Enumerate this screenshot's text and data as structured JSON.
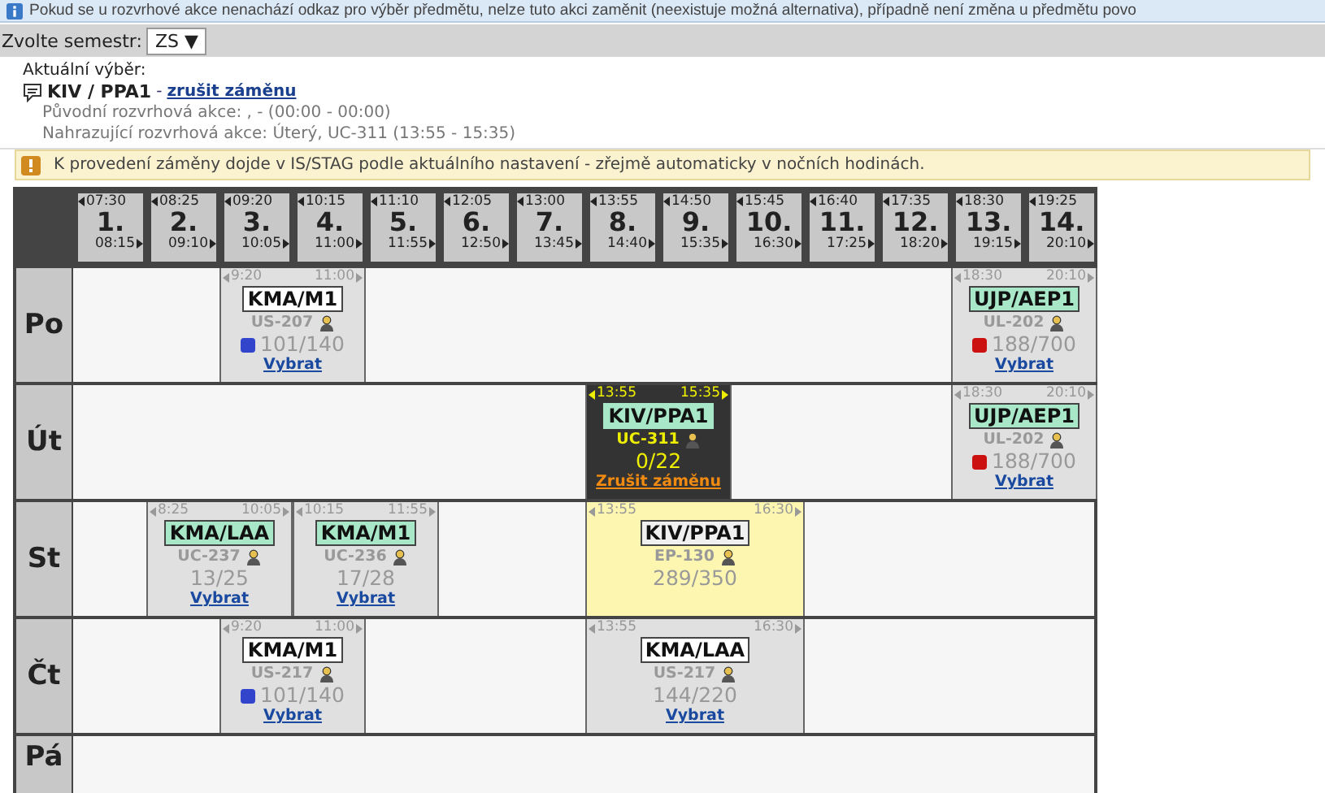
{
  "info_banner": {
    "text": "Pokud se u rozvrhové akce nenachází odkaz pro výběr předmětu, nelze tuto akci zaměnit (neexistuje možná alternativa), případně není změna u předmětu povo"
  },
  "semester": {
    "label": "Zvolte semestr:",
    "value": "ZS",
    "caret": "▼"
  },
  "current_selection": {
    "heading": "Aktuální výběr:",
    "course": "KIV / PPA1",
    "separator": "-",
    "cancel_link": "zrušit záměnu",
    "details": [
      "Původní rozvrhová akce: , - (00:00 - 00:00)",
      "Nahrazující rozvrhová akce: Úterý, UC-311 (13:55 - 15:35)"
    ]
  },
  "warning": {
    "text": "K provedení záměny dojde v IS/STAG podle aktuálního nastavení - zřejmě automaticky v nočních hodinách."
  },
  "timetable": {
    "slots": [
      {
        "number": "1.",
        "start": "07:30",
        "end": "08:15"
      },
      {
        "number": "2.",
        "start": "08:25",
        "end": "09:10"
      },
      {
        "number": "3.",
        "start": "09:20",
        "end": "10:05"
      },
      {
        "number": "4.",
        "start": "10:15",
        "end": "11:00"
      },
      {
        "number": "5.",
        "start": "11:10",
        "end": "11:55"
      },
      {
        "number": "6.",
        "start": "12:05",
        "end": "12:50"
      },
      {
        "number": "7.",
        "start": "13:00",
        "end": "13:45"
      },
      {
        "number": "8.",
        "start": "13:55",
        "end": "14:40"
      },
      {
        "number": "9.",
        "start": "14:50",
        "end": "15:35"
      },
      {
        "number": "10.",
        "start": "15:45",
        "end": "16:30"
      },
      {
        "number": "11.",
        "start": "16:40",
        "end": "17:25"
      },
      {
        "number": "12.",
        "start": "17:35",
        "end": "18:20"
      },
      {
        "number": "13.",
        "start": "18:30",
        "end": "19:15"
      },
      {
        "number": "14.",
        "start": "19:25",
        "end": "20:10"
      }
    ],
    "days": [
      {
        "label": "Po",
        "events": [
          {
            "kind": "normal",
            "start": "9:20",
            "end": "11:00",
            "code": "KMA/M1",
            "color": "#ffffff",
            "room": "US-207",
            "indicator": {
              "color": "#3344cc"
            },
            "capacity": "101/140",
            "link": "Vybrat"
          },
          {
            "kind": "normal",
            "start": "18:30",
            "end": "20:10",
            "code": "UJP/AEP1",
            "color": "#a8e8c8",
            "room": "UL-202",
            "indicator": {
              "color": "#cc1111"
            },
            "capacity": "188/700",
            "link": "Vybrat"
          }
        ]
      },
      {
        "label": "Út",
        "events": [
          {
            "kind": "current",
            "start": "13:55",
            "end": "15:35",
            "code": "KIV/PPA1",
            "color": "#a8e8c8",
            "room": "UC-311",
            "capacity": "0/22",
            "link": "Zrušit záměnu"
          },
          {
            "kind": "normal",
            "start": "18:30",
            "end": "20:10",
            "code": "UJP/AEP1",
            "color": "#a8e8c8",
            "room": "UL-202",
            "indicator": {
              "color": "#cc1111"
            },
            "capacity": "188/700",
            "link": "Vybrat"
          }
        ]
      },
      {
        "label": "St",
        "events": [
          {
            "kind": "normal",
            "start": "8:25",
            "end": "10:05",
            "code": "KMA/LAA",
            "color": "#a8e8c8",
            "room": "UC-237",
            "capacity": "13/25",
            "link": "Vybrat"
          },
          {
            "kind": "normal",
            "start": "10:15",
            "end": "11:55",
            "code": "KMA/M1",
            "color": "#a8e8c8",
            "room": "UC-236",
            "capacity": "17/28",
            "link": "Vybrat"
          },
          {
            "kind": "highlight",
            "start": "13:55",
            "end": "16:30",
            "code": "KIV/PPA1",
            "color": "#f0f0f0",
            "room": "EP-130",
            "capacity": "289/350"
          }
        ]
      },
      {
        "label": "Čt",
        "events": [
          {
            "kind": "normal",
            "start": "9:20",
            "end": "11:00",
            "code": "KMA/M1",
            "color": "#ffffff",
            "room": "US-217",
            "indicator": {
              "color": "#3344cc"
            },
            "capacity": "101/140",
            "link": "Vybrat"
          },
          {
            "kind": "normal",
            "start": "13:55",
            "end": "16:30",
            "code": "KMA/LAA",
            "color": "#ffffff",
            "room": "US-217",
            "capacity": "144/220",
            "link": "Vybrat"
          }
        ]
      },
      {
        "label": "Pá"
      }
    ]
  }
}
